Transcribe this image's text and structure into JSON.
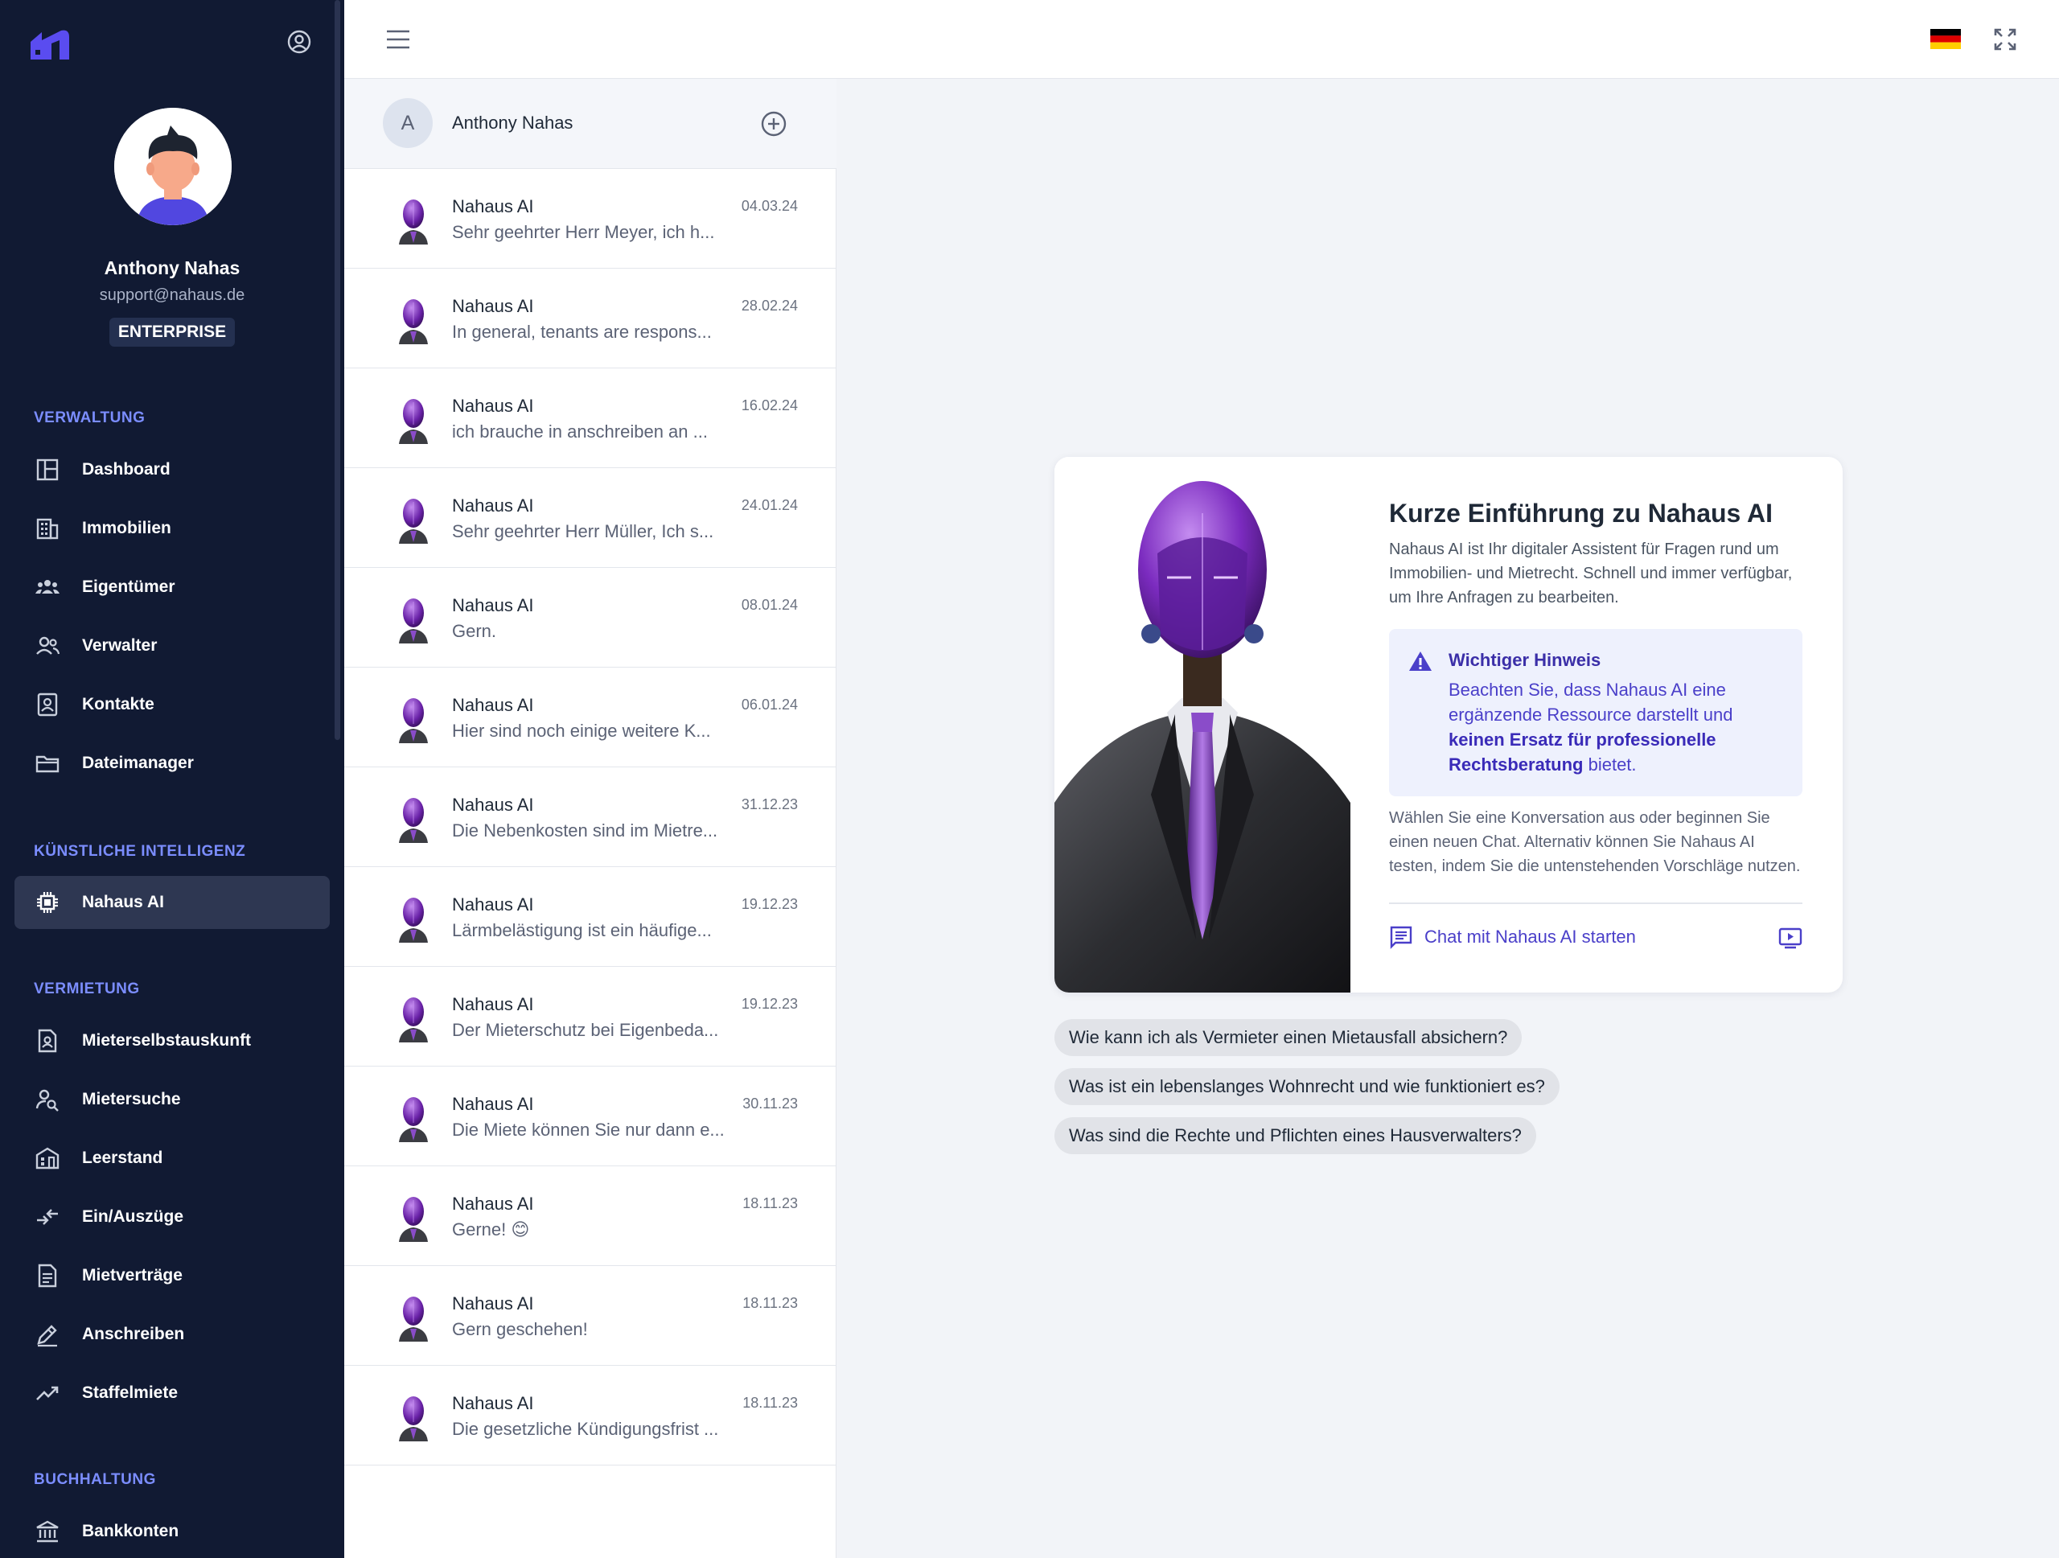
{
  "user": {
    "name": "Anthony Nahas",
    "email": "support@nahaus.de",
    "plan": "ENTERPRISE"
  },
  "sidebar": {
    "sections": [
      {
        "title": "VERWALTUNG"
      },
      {
        "title": "KÜNSTLICHE INTELLIGENZ"
      },
      {
        "title": "VERMIETUNG"
      },
      {
        "title": "BUCHHALTUNG"
      }
    ],
    "items": [
      {
        "label": "Dashboard",
        "icon": "dashboard-icon"
      },
      {
        "label": "Immobilien",
        "icon": "building-icon"
      },
      {
        "label": "Eigentümer",
        "icon": "group-icon"
      },
      {
        "label": "Verwalter",
        "icon": "users-icon"
      },
      {
        "label": "Kontakte",
        "icon": "contact-card-icon"
      },
      {
        "label": "Dateimanager",
        "icon": "folder-icon"
      },
      {
        "label": "Nahaus AI",
        "icon": "chip-icon"
      },
      {
        "label": "Mieterselbstauskunft",
        "icon": "document-user-icon"
      },
      {
        "label": "Mietersuche",
        "icon": "user-search-icon"
      },
      {
        "label": "Leerstand",
        "icon": "vacancy-building-icon"
      },
      {
        "label": "Ein/Auszüge",
        "icon": "move-arrows-icon"
      },
      {
        "label": "Mietverträge",
        "icon": "contract-icon"
      },
      {
        "label": "Anschreiben",
        "icon": "pen-icon"
      },
      {
        "label": "Staffelmiete",
        "icon": "trend-up-icon"
      },
      {
        "label": "Bankkonten",
        "icon": "bank-icon"
      }
    ]
  },
  "chatlist": {
    "header_initial": "A",
    "header_name": "Anthony Nahas",
    "chats": [
      {
        "title": "Nahaus AI",
        "date": "04.03.24",
        "preview": "Sehr geehrter Herr Meyer, ich h..."
      },
      {
        "title": "Nahaus AI",
        "date": "28.02.24",
        "preview": "In general, tenants are respons..."
      },
      {
        "title": "Nahaus AI",
        "date": "16.02.24",
        "preview": "ich brauche in anschreiben an ..."
      },
      {
        "title": "Nahaus AI",
        "date": "24.01.24",
        "preview": "Sehr geehrter Herr Müller, Ich s..."
      },
      {
        "title": "Nahaus AI",
        "date": "08.01.24",
        "preview": "Gern."
      },
      {
        "title": "Nahaus AI",
        "date": "06.01.24",
        "preview": "Hier sind noch einige weitere K..."
      },
      {
        "title": "Nahaus AI",
        "date": "31.12.23",
        "preview": "Die Nebenkosten sind im Mietre..."
      },
      {
        "title": "Nahaus AI",
        "date": "19.12.23",
        "preview": "Lärmbelästigung ist ein häufige..."
      },
      {
        "title": "Nahaus AI",
        "date": "19.12.23",
        "preview": "Der Mieterschutz bei Eigenbeda..."
      },
      {
        "title": "Nahaus AI",
        "date": "30.11.23",
        "preview": "Die Miete können Sie nur dann e..."
      },
      {
        "title": "Nahaus AI",
        "date": "18.11.23",
        "preview": "Gerne! 😊"
      },
      {
        "title": "Nahaus AI",
        "date": "18.11.23",
        "preview": "Gern geschehen!"
      },
      {
        "title": "Nahaus AI",
        "date": "18.11.23",
        "preview": "Die gesetzliche Kündigungsfrist ..."
      }
    ]
  },
  "intro": {
    "title": "Kurze Einführung zu Nahaus AI",
    "description": "Nahaus AI ist Ihr digitaler Assistent für Fragen rund um Immobilien- und Mietrecht. Schnell und immer verfügbar, um Ihre Anfragen zu bearbeiten.",
    "notice_title": "Wichtiger Hinweis",
    "notice_pre": "Beachten Sie, dass Nahaus AI eine ergänzende Ressource darstellt und ",
    "notice_bold": "keinen Ersatz für professionelle Rechtsberatung",
    "notice_post": " bietet.",
    "sub": "Wählen Sie eine Konversation aus oder beginnen Sie einen neuen Chat. Alternativ können Sie Nahaus AI testen, indem Sie die untenstehenden Vorschläge nutzen.",
    "start_label": "Chat mit Nahaus AI starten"
  },
  "suggestions": [
    "Wie kann ich als Vermieter einen Mietausfall absichern?",
    "Was ist ein lebenslanges Wohnrecht und wie funktioniert es?",
    "Was sind die Rechte und Pflichten eines Hausverwalters?"
  ],
  "colors": {
    "sidebar_bg": "#111a33",
    "accent": "#4a3fc9",
    "section_title": "#7b8dff"
  }
}
